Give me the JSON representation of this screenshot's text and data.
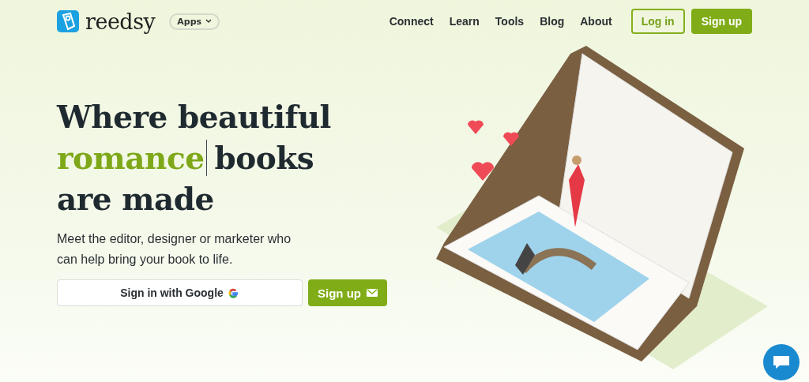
{
  "header": {
    "brand": "reedsy",
    "apps_menu": {
      "label": "Apps",
      "expanded": false
    },
    "nav": [
      {
        "label": "Connect"
      },
      {
        "label": "Learn"
      },
      {
        "label": "Tools"
      },
      {
        "label": "Blog"
      },
      {
        "label": "About"
      }
    ],
    "login": "Log in",
    "signup": "Sign up"
  },
  "hero": {
    "headline": {
      "line_1": "Where beautiful",
      "highlight": "romance",
      "line_2_rest": "books",
      "line_3": "are made"
    },
    "subtitle": "Meet the editor, designer or marketer who can help bring your book to life.",
    "google_button": "Sign in with Google",
    "signup_button": "Sign up"
  }
}
